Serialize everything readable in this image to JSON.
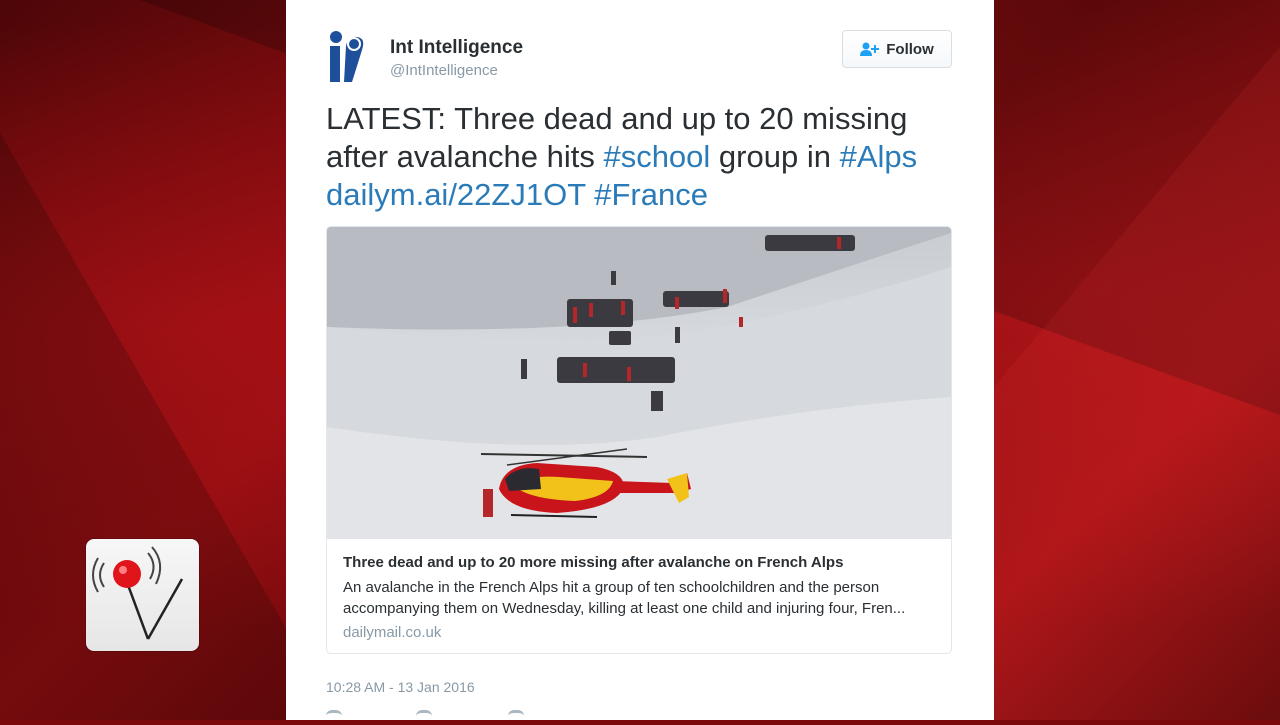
{
  "tweet": {
    "display_name": "Int Intelligence",
    "handle": "@IntIntelligence",
    "follow_label": "Follow",
    "text_parts": {
      "t1": "LATEST: Three dead and up to 20 missing after avalanche hits ",
      "h1": "#school",
      "t2": " group in ",
      "h2": "#Alps",
      "link": "dailym.ai/22ZJ1OT",
      "h3": "#France"
    },
    "card": {
      "title": "Three dead and up to 20 more missing after avalanche on French Alps",
      "description": "An avalanche in the French Alps hit a group of ten schoolchildren and the person accompanying them on Wednesday, killing at least one child and injuring four, Fren...",
      "domain": "dailymail.co.uk"
    },
    "timestamp": "10:28 AM - 13 Jan 2016"
  },
  "icons": {
    "avatar": "int-intelligence-logo-icon",
    "follow": "follow-person-plus-icon",
    "badge": "map-pin-logo-icon"
  },
  "colors": {
    "link": "#2b7bb9",
    "text": "#292f33",
    "muted": "#8899a6",
    "background": "#8e0d10",
    "helicopter_red": "#c8141a",
    "helicopter_yellow": "#f2c21a"
  }
}
